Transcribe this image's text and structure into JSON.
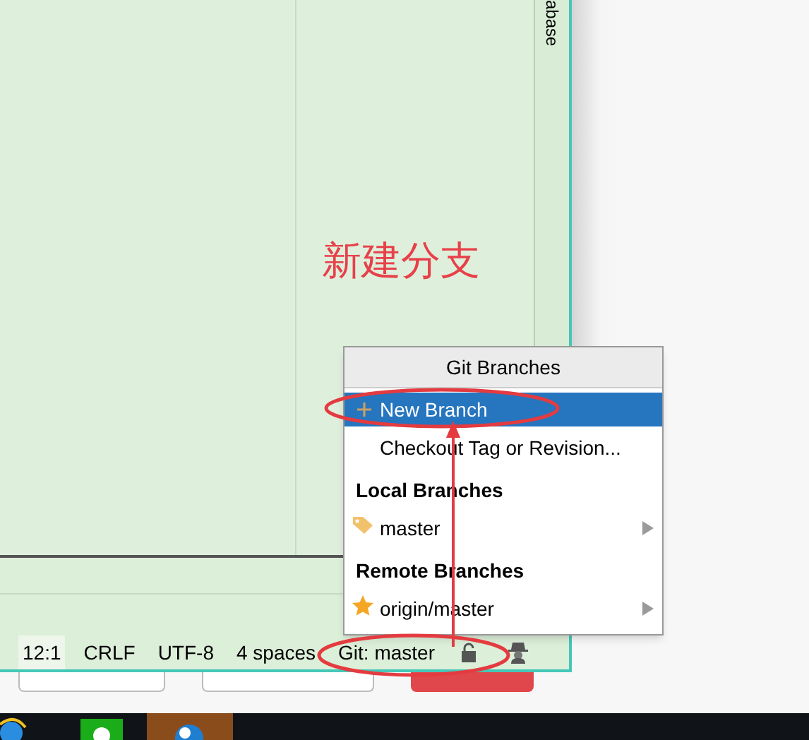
{
  "tool_strip": {
    "label": "abase"
  },
  "annotation": {
    "text": "新建分支"
  },
  "status_bar": {
    "items": [
      {
        "label": "12:1",
        "selected": true
      },
      {
        "label": "CRLF",
        "selected": false
      },
      {
        "label": "UTF-8",
        "selected": false
      },
      {
        "label": "4 spaces",
        "selected": false
      },
      {
        "label": "Git: master",
        "selected": false
      }
    ]
  },
  "popup": {
    "title": "Git Branches",
    "items": [
      {
        "kind": "create",
        "label": "New Branch",
        "selected": true
      },
      {
        "kind": "checkout",
        "label": "Checkout Tag or Revision...",
        "selected": false
      },
      {
        "kind": "header",
        "label": "Local Branches"
      },
      {
        "kind": "local-branch",
        "label": "master",
        "selected": false
      },
      {
        "kind": "header",
        "label": "Remote Branches"
      },
      {
        "kind": "remote-branch",
        "label": "origin/master",
        "selected": false
      }
    ]
  }
}
